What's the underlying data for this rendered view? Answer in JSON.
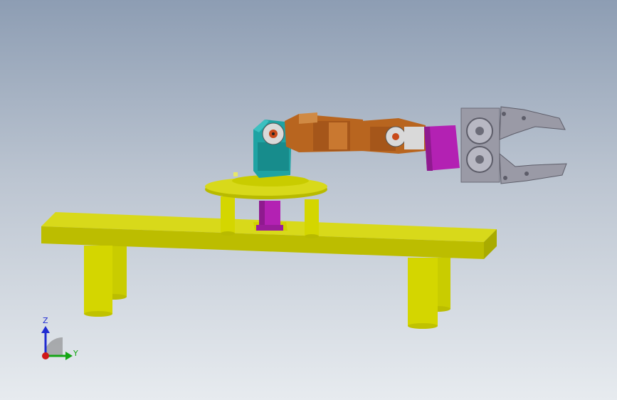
{
  "viewport": {
    "background_top": "#8d9db3",
    "background_bottom": "#e7ebef"
  },
  "model": {
    "parts": [
      "table-top",
      "table-legs",
      "turntable-platform",
      "turntable-support-posts",
      "base-servo",
      "shoulder-servo",
      "upper-arm-link",
      "elbow-servo",
      "wrist-servo",
      "gripper-motor",
      "gripper-jaws"
    ],
    "colors": {
      "table": "#d4d600",
      "table_shadow": "#a8a800",
      "servo_teal": "#1fa3a3",
      "link_orange": "#b8651f",
      "motor_magenta": "#b321b3",
      "gripper_gray": "#9a9aa6",
      "servo_white": "#d9d9d9"
    }
  },
  "triad": {
    "z_label": "Z",
    "y_label": "Y",
    "z_color": "#1f2bd1",
    "y_color": "#15a615",
    "x_color": "#d01818"
  }
}
